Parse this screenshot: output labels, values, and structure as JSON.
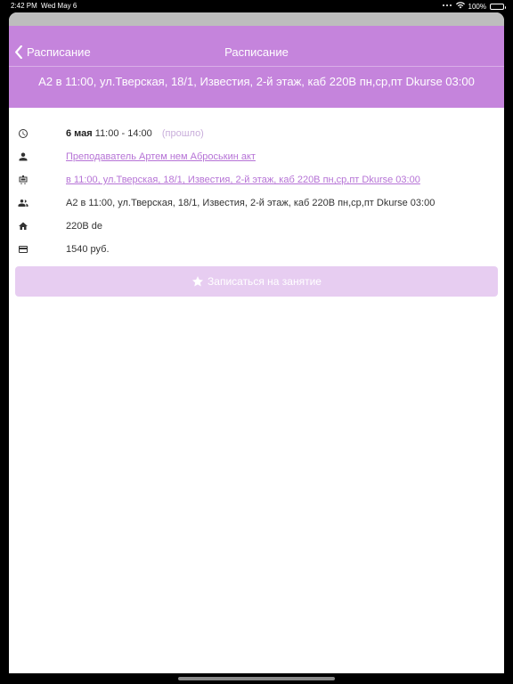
{
  "status_bar": {
    "time": "2:42 PM",
    "date": "Wed May 6",
    "battery": "100%",
    "icons": [
      "signal-icon",
      "wifi-icon",
      "battery-icon"
    ]
  },
  "nav": {
    "back_label": "Расписание",
    "title": "Расписание",
    "subtitle": "A2 в 11:00, ул.Тверская, 18/1, Известия, 2-й этаж, каб 220B пн,ср,пт Dkurse 03:00"
  },
  "details": {
    "date_bold": "6 мая",
    "time_range": "11:00 - 14:00",
    "status": "(прошло)",
    "teacher": "Преподаватель Артем нем Аброськин акт",
    "course_link": "в 11:00, ул.Тверская, 18/1, Известия, 2-й этаж, каб 220B пн,ср,пт Dkurse 03:00",
    "group": "A2 в 11:00, ул.Тверская, 18/1, Известия, 2-й этаж, каб 220B пн,ср,пт Dkurse 03:00",
    "room": "220B de",
    "price": "1540 руб."
  },
  "enroll_button": {
    "label": "Записаться на занятие"
  },
  "colors": {
    "accent": "#c584dc",
    "link": "#b673d6",
    "button_disabled": "#e7cdf1",
    "muted": "#c9aedb"
  }
}
